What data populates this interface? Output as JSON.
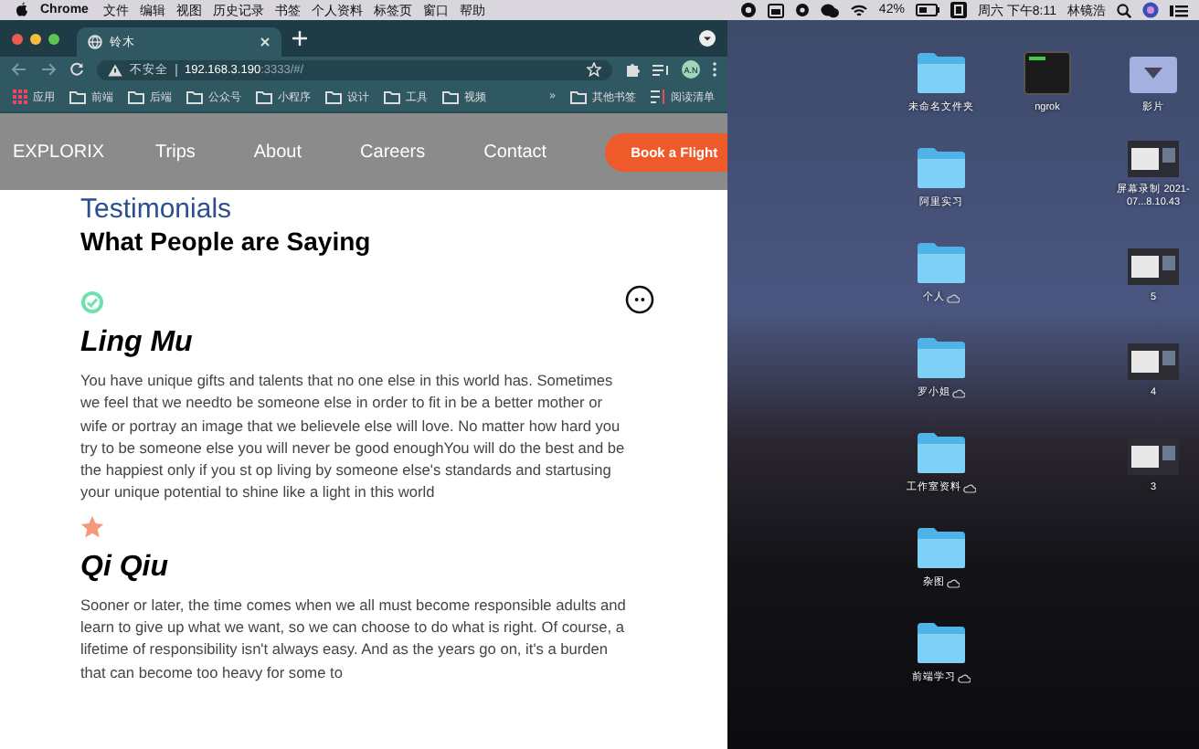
{
  "menu_bar": {
    "app": "Chrome",
    "menus": [
      "文件",
      "编辑",
      "视图",
      "历史记录",
      "书签",
      "个人资料",
      "标签页",
      "窗口",
      "帮助"
    ],
    "battery": "42%",
    "clock": "周六 下午8:11",
    "user": "林镜浩"
  },
  "browser": {
    "tab": {
      "title": "铃木"
    },
    "address": {
      "security": "不安全",
      "host": "192.168.3.190",
      "rest": ":3333/#/"
    },
    "profile": "A.N",
    "bookmarks": [
      {
        "label": "应用",
        "kind": "apps"
      },
      {
        "label": "前端",
        "kind": "folder"
      },
      {
        "label": "后端",
        "kind": "folder"
      },
      {
        "label": "公众号",
        "kind": "folder"
      },
      {
        "label": "小程序",
        "kind": "folder"
      },
      {
        "label": "设计",
        "kind": "folder"
      },
      {
        "label": "工具",
        "kind": "folder"
      },
      {
        "label": "视频",
        "kind": "folder"
      }
    ],
    "overflow": "»",
    "other_bookmarks": "其他书签",
    "reading_list": "阅读清单"
  },
  "page": {
    "nav": {
      "logo": "EXPLORIX",
      "links": [
        "Trips",
        "About",
        "Careers",
        "Contact"
      ],
      "cta": "Book a Flight"
    },
    "section_title": "Testimonials",
    "heading": "What People are Saying",
    "testimonials": [
      {
        "kind": "check",
        "name": "Ling Mu",
        "text": "You have unique gifts and talents that no one else in this world has. Sometimes we feel that we needto be someone else in order to fit in be a better mother or wife or portray an image that we believele else will love. No matter how hard you try to be someone else you will never be good enoughYou will do the best and be the happiest only if you st op living by someone else's standards and startusing your unique potential to shine like a light in this world"
      },
      {
        "kind": "star",
        "name": "Qi Qiu",
        "text": "Sooner or later, the time comes when we all must become responsible adults and learn to give up what we want, so we can choose to do what is right. Of course, a lifetime of responsibility isn't always easy. And as the years go on, it's a burden that can become too heavy for some to"
      }
    ]
  },
  "desktop": {
    "columns": [
      [
        {
          "label": "未命名文件夹",
          "kind": "folder",
          "cloud": false
        },
        {
          "label": "阿里实习",
          "kind": "folder",
          "cloud": false
        },
        {
          "label": "个人",
          "kind": "folder",
          "cloud": true
        },
        {
          "label": "罗小姐",
          "kind": "folder",
          "cloud": true
        },
        {
          "label": "工作室资料",
          "kind": "folder",
          "cloud": true
        },
        {
          "label": "杂图",
          "kind": "folder",
          "cloud": true
        },
        {
          "label": "前端学习",
          "kind": "folder",
          "cloud": true
        }
      ],
      [
        {
          "label": "ngrok",
          "kind": "terminal",
          "cloud": false
        }
      ],
      [
        {
          "label": "影片",
          "kind": "drive",
          "cloud": false
        },
        {
          "label": "屏幕录制 2021-07...8.10.43",
          "kind": "screenshot",
          "cloud": false
        },
        {
          "label": "5",
          "kind": "screenshot",
          "cloud": false
        },
        {
          "label": "4",
          "kind": "screenshot",
          "cloud": false
        },
        {
          "label": "3",
          "kind": "screenshot",
          "cloud": false
        }
      ]
    ]
  }
}
